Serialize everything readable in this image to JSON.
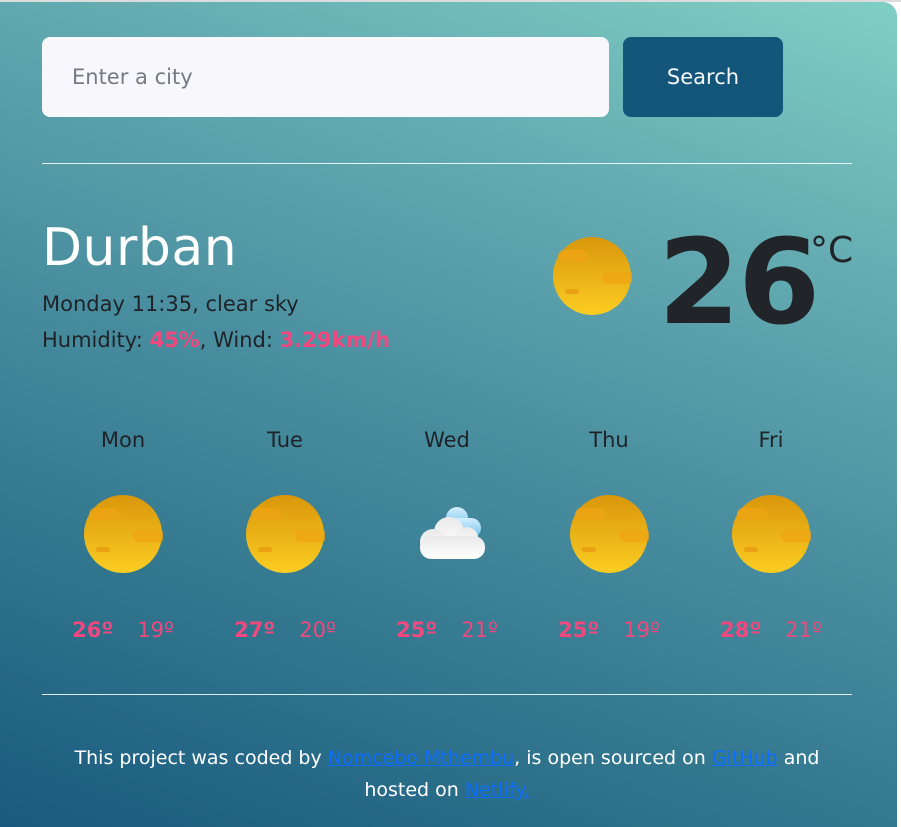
{
  "search": {
    "placeholder": "Enter a city",
    "value": "",
    "button_label": "Search"
  },
  "current": {
    "city": "Durban",
    "datetime": "Monday 11:35",
    "description": "clear sky",
    "humidity_label": "Humidity:",
    "humidity_value": "45%",
    "wind_label": "Wind:",
    "wind_value": "3.29km/h",
    "temperature": "26",
    "unit": "°C",
    "icon": "sun-icon"
  },
  "forecast": [
    {
      "day": "Mon",
      "icon": "sun-icon",
      "max": "26º",
      "min": "19º"
    },
    {
      "day": "Tue",
      "icon": "sun-icon",
      "max": "27º",
      "min": "20º"
    },
    {
      "day": "Wed",
      "icon": "cloud-icon",
      "max": "25º",
      "min": "21º"
    },
    {
      "day": "Thu",
      "icon": "sun-icon",
      "max": "25º",
      "min": "19º"
    },
    {
      "day": "Fri",
      "icon": "sun-icon",
      "max": "28º",
      "min": "21º"
    }
  ],
  "footer": {
    "text1": "This project was coded by ",
    "author_link": "Nomcebo Mthembu",
    "text2": ", is open sourced on ",
    "github_link": "GitHub",
    "text3": " and hosted on ",
    "netlify_link": "Netlify."
  },
  "colors": {
    "accent_pink": "#f0487f",
    "button_blue": "#14557a",
    "link_blue": "#0d6efd",
    "gradient_top": "#80cfc4",
    "gradient_bottom": "#1a5a7e"
  }
}
